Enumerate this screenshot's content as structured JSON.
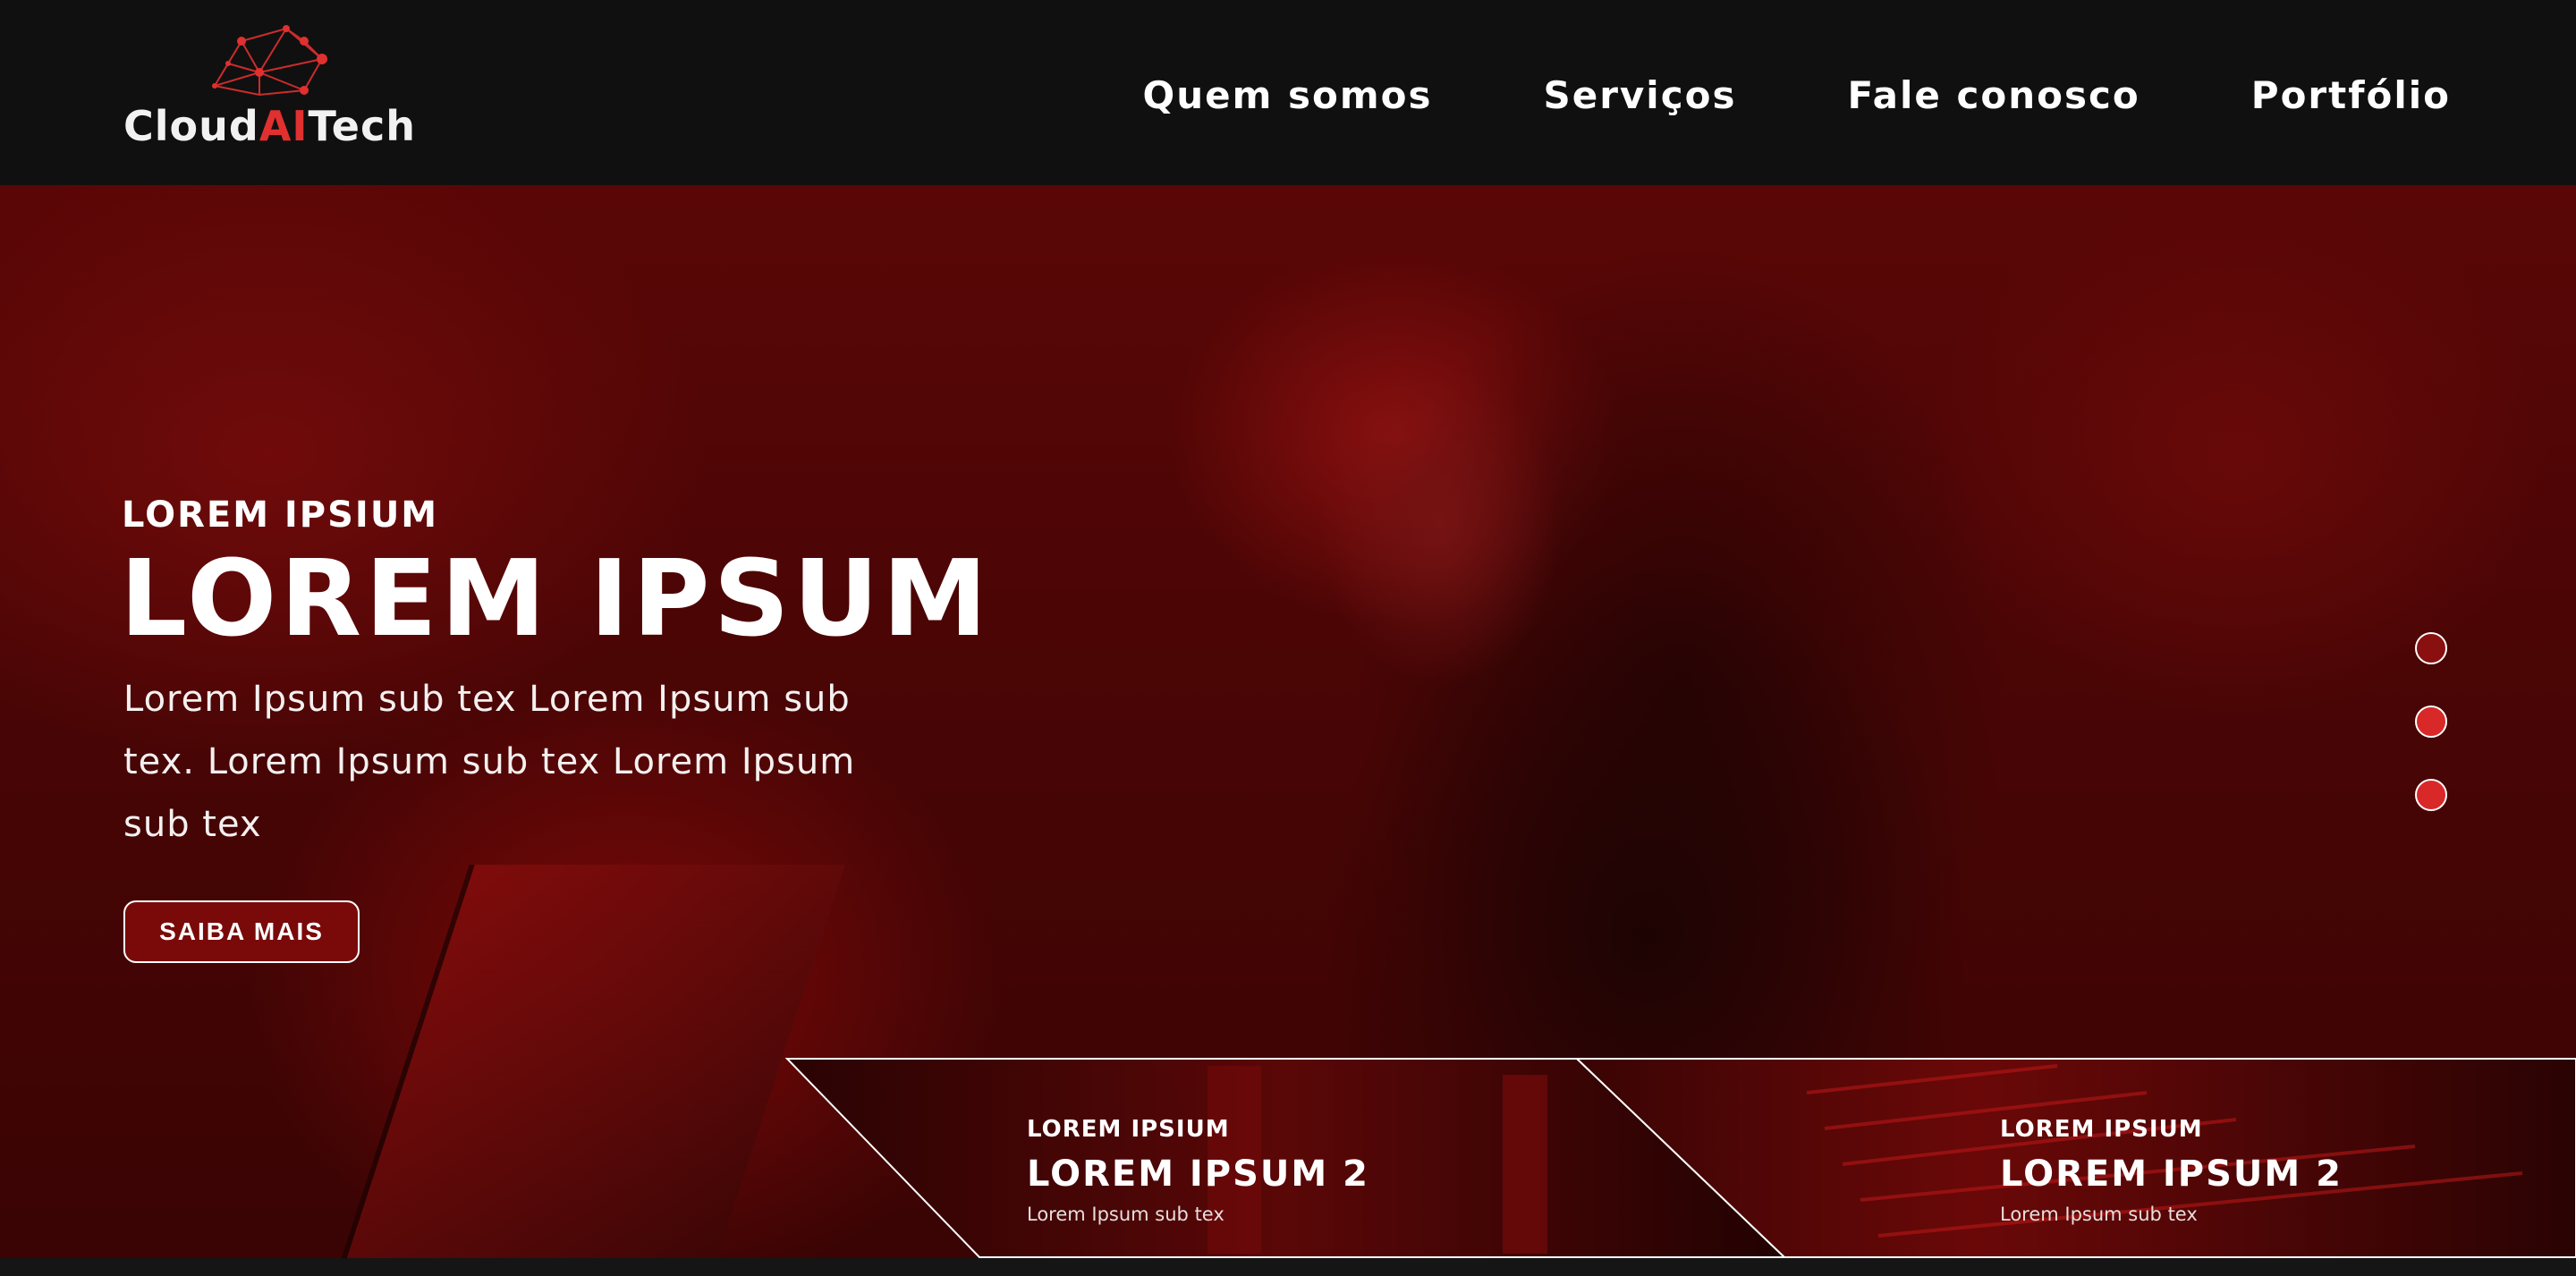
{
  "brand": {
    "name_part1": "Cloud",
    "name_part2": "AI",
    "name_part3": "Tech",
    "accent_color": "#e03030",
    "logo_icon": "network-cloud-icon"
  },
  "nav": {
    "items": [
      {
        "label": "Quem somos"
      },
      {
        "label": "Serviços"
      },
      {
        "label": "Fale conosco"
      },
      {
        "label": "Portfólio"
      }
    ]
  },
  "hero": {
    "eyebrow": "LOREM IPSIUM",
    "title": "LOREM IPSUM",
    "subtitle": "Lorem Ipsum sub tex Lorem Ipsum sub tex. Lorem Ipsum sub tex Lorem Ipsum sub tex",
    "button_label": "SAIBA MAIS",
    "background_color": "#5a0606",
    "slide_count": 3,
    "active_slide": 1
  },
  "cards": [
    {
      "eyebrow": "LOREM IPSIUM",
      "title": "LOREM IPSUM 2",
      "subtitle": "Lorem Ipsum sub tex"
    },
    {
      "eyebrow": "LOREM IPSIUM",
      "title": "LOREM IPSUM 2",
      "subtitle": "Lorem Ipsum sub tex"
    }
  ]
}
